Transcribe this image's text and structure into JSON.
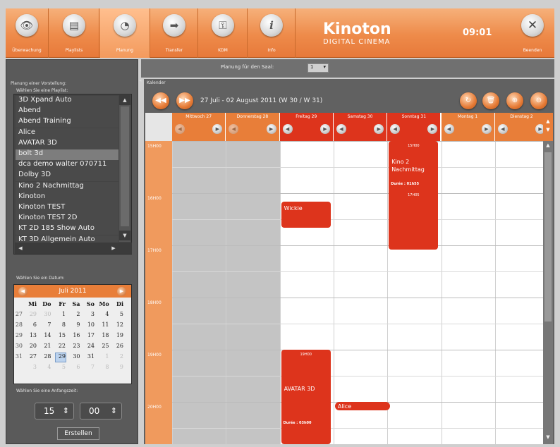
{
  "toolbar": {
    "buttons": [
      {
        "label": "Überwachung",
        "icon": "eye-icon",
        "glyph": "👁"
      },
      {
        "label": "Playlists",
        "icon": "document-icon",
        "glyph": "▤"
      },
      {
        "label": "Planung",
        "icon": "clock-icon",
        "glyph": "◔"
      },
      {
        "label": "Transfer",
        "icon": "arrow-right-icon",
        "glyph": "➡"
      },
      {
        "label": "KDM",
        "icon": "key-icon",
        "glyph": "⚿"
      },
      {
        "label": "Info",
        "icon": "info-icon",
        "glyph": "i"
      }
    ],
    "brand": "Kinoton",
    "brand_sub": "DIGITAL CINEMA",
    "clock": "09:01",
    "exit_label": "Beenden",
    "exit_glyph": "✕"
  },
  "left": {
    "section": "Planung einer Vorstellung:",
    "playlist_label": "Wählen Sie eine Playlist:",
    "playlists": [
      "3D Xpand Auto",
      "Abend",
      "Abend Training",
      "Alice",
      "AVATAR 3D",
      "bolt 3d",
      "dca demo walter 070711",
      "Dolby 3D",
      "Kino 2 Nachmittag",
      "Kinoton",
      "Kinoton TEST",
      "Kinoton TEST 2D",
      "KT 2D 185 Show Auto",
      "KT 3D Allgemein Auto"
    ],
    "selected_playlist": "bolt 3d",
    "date_label": "Wählen Sie ein Datum:",
    "month": "Juli 2011",
    "weekdays": [
      "Mi",
      "Do",
      "Fr",
      "Sa",
      "So",
      "Mo",
      "Di"
    ],
    "weeks": [
      {
        "wk": "27",
        "days": [
          "29",
          "30",
          "1",
          "2",
          "3",
          "4",
          "5"
        ]
      },
      {
        "wk": "28",
        "days": [
          "6",
          "7",
          "8",
          "9",
          "10",
          "11",
          "12"
        ]
      },
      {
        "wk": "29",
        "days": [
          "13",
          "14",
          "15",
          "16",
          "17",
          "18",
          "19"
        ]
      },
      {
        "wk": "30",
        "days": [
          "20",
          "21",
          "22",
          "23",
          "24",
          "25",
          "26"
        ]
      },
      {
        "wk": "31",
        "days": [
          "27",
          "28",
          "29",
          "30",
          "31",
          "1",
          "2"
        ]
      },
      {
        "wk": "",
        "days": [
          "3",
          "4",
          "5",
          "6",
          "7",
          "8",
          "9"
        ]
      }
    ],
    "selected_day": "29",
    "time_label": "Wählen Sie eine Anfangszeit:",
    "hour": "15",
    "minute": "00",
    "create_label": "Erstellen"
  },
  "saal": {
    "label": "Planung für den Saal:",
    "value": "1"
  },
  "calendar": {
    "section": "Kalender",
    "range": "27 Juli - 02 August 2011 (W 30 / W 31)",
    "days": [
      {
        "name": "Mittwoch 27",
        "state": "past"
      },
      {
        "name": "Donnerstag 28",
        "state": "past"
      },
      {
        "name": "Freitag 29",
        "state": "active"
      },
      {
        "name": "Samstag 30",
        "state": "active"
      },
      {
        "name": "Sonntag 31",
        "state": "active"
      },
      {
        "name": "Montag 1",
        "state": "future"
      },
      {
        "name": "Dienstag 2",
        "state": "future"
      }
    ],
    "hours": [
      "15H00",
      "16H00",
      "17H00",
      "18H00",
      "19H00",
      "20H00"
    ],
    "events": [
      {
        "day": 2,
        "start": "16:10",
        "end": "16:40",
        "title": "Wickie",
        "sub": "",
        "bottom": ""
      },
      {
        "day": 4,
        "start": "15:00",
        "end": "17:05",
        "title": "Kino 2 Nachmittag",
        "sub": "15H00",
        "dur": "Durée : 01h55",
        "bottom": "17H05"
      },
      {
        "day": 2,
        "start": "19:00",
        "end": "22:00",
        "title": "AVATAR 3D",
        "sub": "19H00",
        "dur": "Durée : 03h00",
        "bottom": ""
      },
      {
        "day": 3,
        "start": "20:00",
        "end": "20:10",
        "title": "Alice",
        "sub": "",
        "bottom": ""
      }
    ],
    "colors": {
      "accent": "#e87e39",
      "event": "#dd341c",
      "past": "#c4c4c4"
    }
  }
}
